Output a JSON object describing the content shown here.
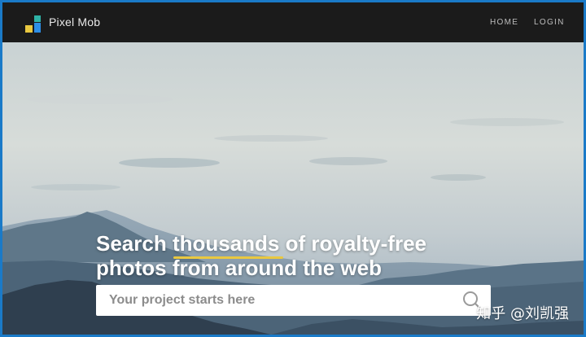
{
  "navbar": {
    "brand": "Pixel Mob",
    "links": [
      {
        "label": "HOME"
      },
      {
        "label": "LOGIN"
      }
    ]
  },
  "hero": {
    "headline_line1": "Search thousands of royalty-free",
    "headline_line2": "photos from around the web"
  },
  "search": {
    "placeholder": "Your project starts here",
    "value": ""
  },
  "watermark": "知乎 @刘凯强",
  "colors": {
    "navbar_bg": "#1b1b1b",
    "logo_teal": "#2fb3a7",
    "logo_yellow": "#e9c840",
    "logo_blue": "#2d8ee6",
    "underline_accent": "#e9c840",
    "frame_border": "#1a7ac8"
  },
  "icons": {
    "search": "search-icon",
    "logo": "pixel-mob-logo-icon"
  }
}
